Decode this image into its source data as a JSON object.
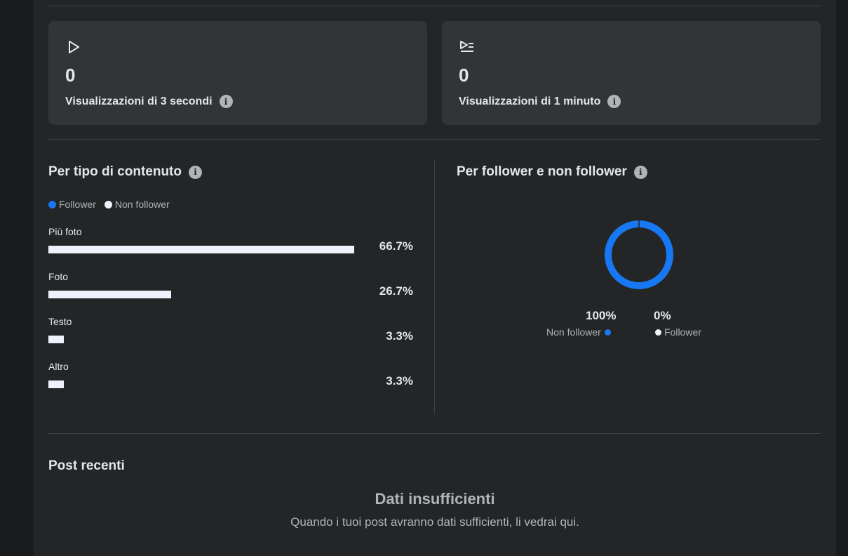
{
  "cards": [
    {
      "value": "0",
      "label": "Visualizzazioni di 3 secondi",
      "icon": "play-icon"
    },
    {
      "value": "0",
      "label": "Visualizzazioni di 1 minuto",
      "icon": "play-list-icon"
    }
  ],
  "content_type": {
    "title": "Per tipo di contenuto",
    "legend": [
      "Follower",
      "Non follower"
    ]
  },
  "follower_section": {
    "title": "Per follower e non follower",
    "non_follower_pct": "100%",
    "non_follower_label": "Non follower",
    "follower_pct": "0%",
    "follower_label": "Follower"
  },
  "recent_posts": {
    "title": "Post recenti",
    "empty_title": "Dati insufficienti",
    "empty_message": "Quando i tuoi post avranno dati sufficienti, li vedrai qui."
  },
  "colors": {
    "follower": "#1877f2",
    "non_follower": "#eef2fb",
    "donut": "#1877f2"
  },
  "chart_data": [
    {
      "type": "bar",
      "categories": [
        "Più foto",
        "Foto",
        "Testo",
        "Altro"
      ],
      "values": [
        66.7,
        26.7,
        3.3,
        3.3
      ],
      "labels": [
        "66.7%",
        "26.7%",
        "3.3%",
        "3.3%"
      ],
      "title": "Per tipo di contenuto",
      "legend": [
        "Follower",
        "Non follower"
      ]
    },
    {
      "type": "pie",
      "categories": [
        "Non follower",
        "Follower"
      ],
      "values": [
        100,
        0
      ],
      "title": "Per follower e non follower"
    }
  ]
}
